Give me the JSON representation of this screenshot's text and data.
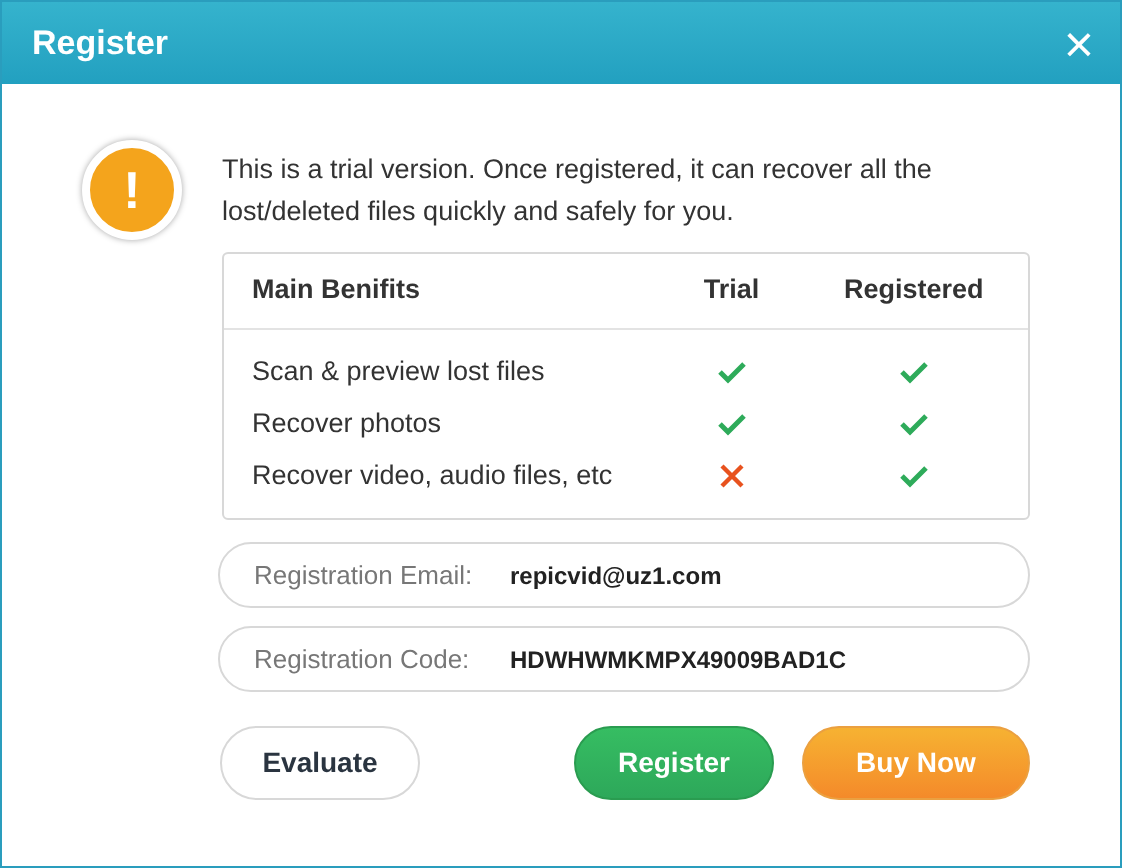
{
  "window": {
    "title": "Register",
    "close": "×"
  },
  "message": "This is a trial version. Once registered, it can recover all the lost/deleted files quickly and safely for you.",
  "warning_icon": "!",
  "table": {
    "columns": [
      "Main Benifits",
      "Trial",
      "Registered"
    ],
    "rows": [
      {
        "feature": "Scan & preview lost files",
        "trial": true,
        "registered": true
      },
      {
        "feature": "Recover photos",
        "trial": true,
        "registered": true
      },
      {
        "feature": "Recover video, audio files, etc",
        "trial": false,
        "registered": true
      }
    ]
  },
  "fields": [
    {
      "label": "Registration Email:",
      "value": "repicvid@uz1.com"
    },
    {
      "label": "Registration Code:",
      "value": "HDWHWMKMPX49009BAD1C"
    }
  ],
  "buttons": [
    {
      "label": "Evaluate",
      "kind": "plain"
    },
    {
      "label": "Register",
      "kind": "green"
    },
    {
      "label": "Buy Now",
      "kind": "orange"
    }
  ]
}
